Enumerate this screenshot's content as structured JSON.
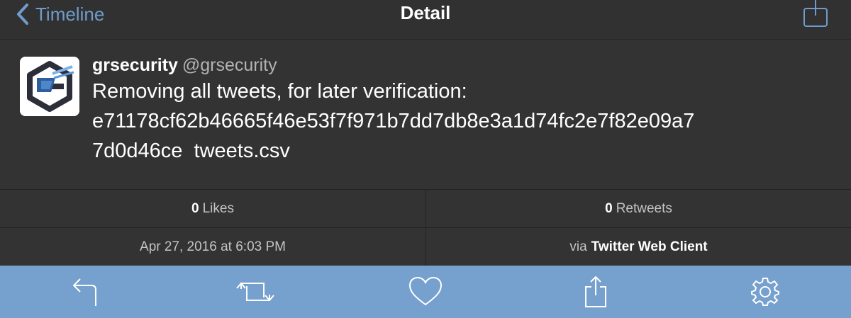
{
  "nav": {
    "back_label": "Timeline",
    "title": "Detail"
  },
  "tweet": {
    "display_name": "grsecurity",
    "handle": "@grsecurity",
    "text": "Removing all tweets, for later verification:\ne71178cf62b46665f46e53f7f971b7dd7db8e3a1d74fc2e7f82e09a7\n7d0d46ce  tweets.csv"
  },
  "stats": {
    "likes_count": "0",
    "likes_label": "Likes",
    "retweets_count": "0",
    "retweets_label": "Retweets",
    "timestamp": "Apr 27, 2016 at 6:03 PM",
    "via_prefix": "via",
    "client": "Twitter Web Client"
  },
  "colors": {
    "accent": "#6f9ccd",
    "tabbar": "#76a0cd",
    "background": "#333333"
  },
  "toolbar_icons": [
    "reply-icon",
    "retweet-icon",
    "like-icon",
    "share-icon",
    "settings-icon"
  ]
}
